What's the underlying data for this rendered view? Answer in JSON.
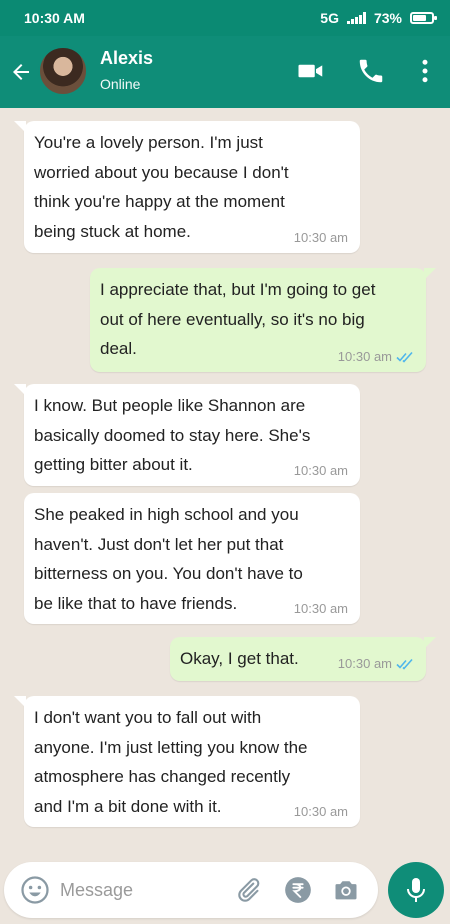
{
  "status_bar": {
    "time": "10:30 AM",
    "network": "5G",
    "battery_percent": "73%",
    "battery_level": 0.73
  },
  "header": {
    "name": "Alexis",
    "status": "Online",
    "accent_color": "#0f8d78"
  },
  "messages": [
    {
      "direction": "incoming",
      "text": "You're a lovely person. I'm just\nworried about you because I don't\nthink you're happy at the moment\nbeing stuck at home.",
      "time": "10:30 am"
    },
    {
      "direction": "outgoing",
      "text": "I appreciate that, but I'm going to get\nout of here eventually, so it's no big\ndeal.",
      "time": "10:30 am",
      "read": true
    },
    {
      "direction": "incoming",
      "text": "I know. But people like Shannon are\nbasically doomed to stay here. She's\ngetting bitter about it.",
      "time": "10:30 am"
    },
    {
      "direction": "incoming",
      "text": "She peaked in high school and you\nhaven't. Just don't let her put that\nbitterness on you. You don't have to\nbe like that to have friends.",
      "time": "10:30 am"
    },
    {
      "direction": "outgoing",
      "text": "Okay, I get that.",
      "time": "10:30 am",
      "read": true
    },
    {
      "direction": "incoming",
      "text": "I don't want you to fall out with\nanyone. I'm just letting you know the\natmosphere has changed recently\nand I'm a bit done with it.",
      "time": "10:30 am"
    }
  ],
  "composer": {
    "placeholder": "Message"
  },
  "icons": {
    "back": "arrow-left-icon",
    "video": "video-camera-icon",
    "call": "phone-icon",
    "menu": "more-vertical-icon",
    "emoji": "emoji-icon",
    "attach": "paperclip-icon",
    "payment": "rupee-icon",
    "camera": "camera-icon",
    "mic": "microphone-icon"
  }
}
